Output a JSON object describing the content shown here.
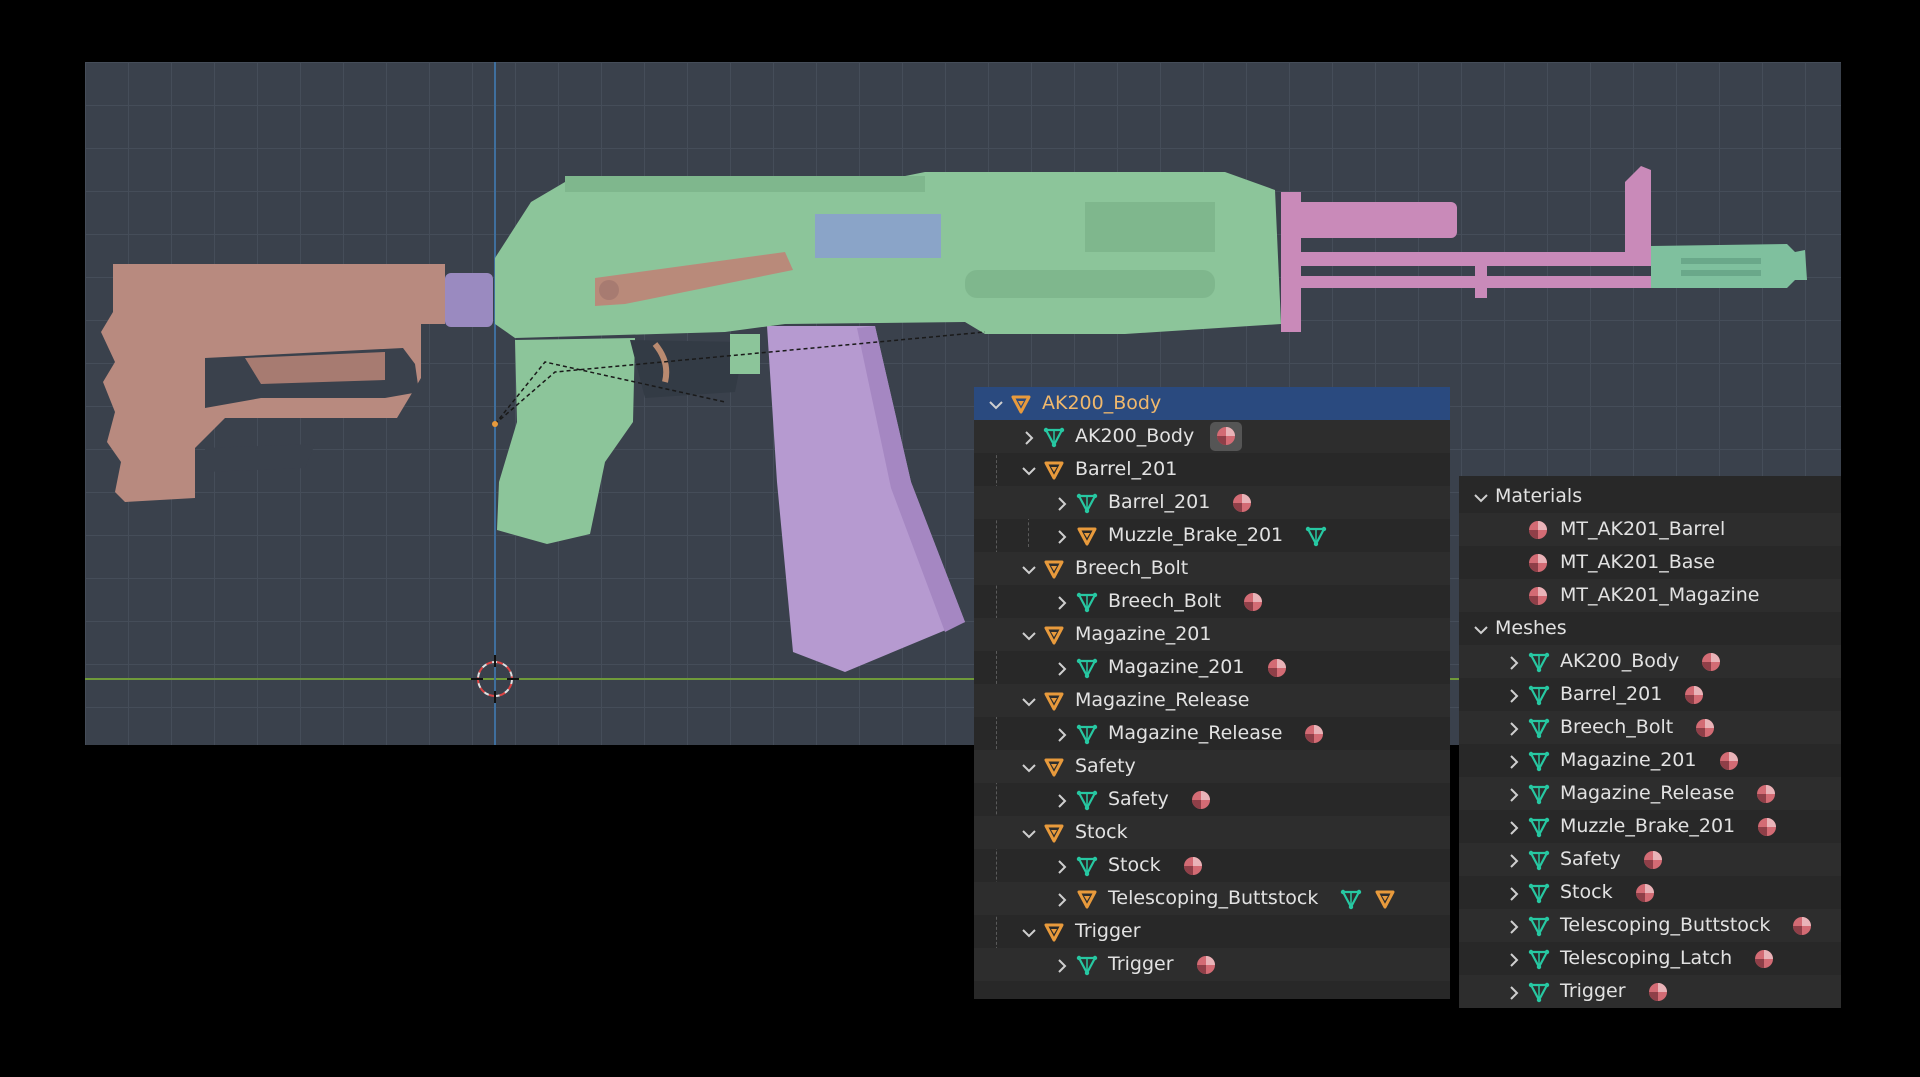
{
  "colors": {
    "viewport_bg": "#3a414c",
    "panel_bg": "#282828",
    "selected_row": "#2a4a7f",
    "collection_orange": "#e89a3c",
    "mesh_green": "#27c8a2",
    "material_red": "#d36b74",
    "body_green": "#8cc59a",
    "stock_brown": "#b88a7f",
    "barrel_pink": "#c98ab9",
    "magazine_purple": "#b69ad0",
    "bolt_blue": "#8aa4c8"
  },
  "viewport": {
    "model_name": "AK200 assault rifle model",
    "cursor_icon": "3d-cursor-icon"
  },
  "outliner": {
    "rows": [
      {
        "label": "AK200_Body",
        "type": "collection",
        "indent": 0,
        "expanded": true,
        "selected": true
      },
      {
        "label": "AK200_Body",
        "type": "mesh",
        "indent": 1,
        "expanded": false,
        "trail": [
          "material-active"
        ]
      },
      {
        "label": "Barrel_201",
        "type": "collection",
        "indent": 1,
        "expanded": true
      },
      {
        "label": "Barrel_201",
        "type": "mesh",
        "indent": 2,
        "expanded": false,
        "trail": [
          "material"
        ]
      },
      {
        "label": "Muzzle_Brake_201",
        "type": "collection",
        "indent": 2,
        "expanded": false,
        "trail": [
          "mesh"
        ]
      },
      {
        "label": "Breech_Bolt",
        "type": "collection",
        "indent": 1,
        "expanded": true
      },
      {
        "label": "Breech_Bolt",
        "type": "mesh",
        "indent": 2,
        "expanded": false,
        "trail": [
          "material"
        ]
      },
      {
        "label": "Magazine_201",
        "type": "collection",
        "indent": 1,
        "expanded": true
      },
      {
        "label": "Magazine_201",
        "type": "mesh",
        "indent": 2,
        "expanded": false,
        "trail": [
          "material"
        ]
      },
      {
        "label": "Magazine_Release",
        "type": "collection",
        "indent": 1,
        "expanded": true
      },
      {
        "label": "Magazine_Release",
        "type": "mesh",
        "indent": 2,
        "expanded": false,
        "trail": [
          "material"
        ]
      },
      {
        "label": "Safety",
        "type": "collection",
        "indent": 1,
        "expanded": true
      },
      {
        "label": "Safety",
        "type": "mesh",
        "indent": 2,
        "expanded": false,
        "trail": [
          "material"
        ]
      },
      {
        "label": "Stock",
        "type": "collection",
        "indent": 1,
        "expanded": true
      },
      {
        "label": "Stock",
        "type": "mesh",
        "indent": 2,
        "expanded": false,
        "trail": [
          "material"
        ]
      },
      {
        "label": "Telescoping_Buttstock",
        "type": "collection",
        "indent": 2,
        "expanded": false,
        "trail": [
          "mesh",
          "collection"
        ]
      },
      {
        "label": "Trigger",
        "type": "collection",
        "indent": 1,
        "expanded": true
      },
      {
        "label": "Trigger",
        "type": "mesh",
        "indent": 2,
        "expanded": false,
        "trail": [
          "material"
        ]
      }
    ]
  },
  "data_panel": {
    "rows": [
      {
        "label": "Materials",
        "type": "group",
        "indent": 0,
        "expanded": true
      },
      {
        "label": "MT_AK201_Barrel",
        "type": "material",
        "indent": 1
      },
      {
        "label": "MT_AK201_Base",
        "type": "material",
        "indent": 1
      },
      {
        "label": "MT_AK201_Magazine",
        "type": "material",
        "indent": 1
      },
      {
        "label": "Meshes",
        "type": "group",
        "indent": 0,
        "expanded": true
      },
      {
        "label": "AK200_Body",
        "type": "mesh",
        "indent": 1,
        "expanded": false,
        "trail": [
          "material"
        ]
      },
      {
        "label": "Barrel_201",
        "type": "mesh",
        "indent": 1,
        "expanded": false,
        "trail": [
          "material"
        ]
      },
      {
        "label": "Breech_Bolt",
        "type": "mesh",
        "indent": 1,
        "expanded": false,
        "trail": [
          "material"
        ]
      },
      {
        "label": "Magazine_201",
        "type": "mesh",
        "indent": 1,
        "expanded": false,
        "trail": [
          "material"
        ]
      },
      {
        "label": "Magazine_Release",
        "type": "mesh",
        "indent": 1,
        "expanded": false,
        "trail": [
          "material"
        ]
      },
      {
        "label": "Muzzle_Brake_201",
        "type": "mesh",
        "indent": 1,
        "expanded": false,
        "trail": [
          "material"
        ]
      },
      {
        "label": "Safety",
        "type": "mesh",
        "indent": 1,
        "expanded": false,
        "trail": [
          "material"
        ]
      },
      {
        "label": "Stock",
        "type": "mesh",
        "indent": 1,
        "expanded": false,
        "trail": [
          "material"
        ]
      },
      {
        "label": "Telescoping_Buttstock",
        "type": "mesh",
        "indent": 1,
        "expanded": false,
        "trail": [
          "material"
        ]
      },
      {
        "label": "Telescoping_Latch",
        "type": "mesh",
        "indent": 1,
        "expanded": false,
        "trail": [
          "material"
        ]
      },
      {
        "label": "Trigger",
        "type": "mesh",
        "indent": 1,
        "expanded": false,
        "trail": [
          "material"
        ]
      }
    ]
  }
}
